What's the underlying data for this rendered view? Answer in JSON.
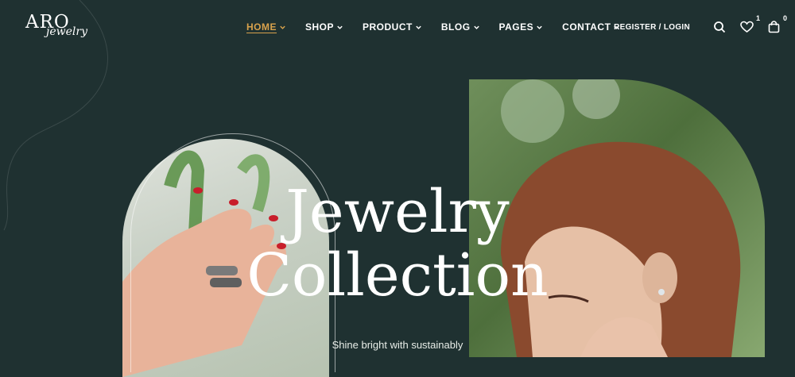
{
  "logo": {
    "main": "ARO",
    "script": "jewelry"
  },
  "nav": {
    "items": [
      {
        "label": "HOME",
        "active": true
      },
      {
        "label": "SHOP",
        "active": false
      },
      {
        "label": "PRODUCT",
        "active": false
      },
      {
        "label": "BLOG",
        "active": false
      },
      {
        "label": "PAGES",
        "active": false
      },
      {
        "label": "CONTACT",
        "active": false
      }
    ]
  },
  "header": {
    "register_login": "REGISTER / LOGIN",
    "wishlist_count": "1",
    "cart_count": "0"
  },
  "hero": {
    "title_line1": "Jewelry",
    "title_line2": "Collection",
    "subtitle": "Shine bright with sustainably"
  },
  "colors": {
    "background": "#1f3131",
    "accent": "#d8a24c",
    "text": "#ffffff"
  },
  "icons": [
    "search-icon",
    "heart-icon",
    "shopping-bag-icon",
    "chevron-down-icon"
  ]
}
